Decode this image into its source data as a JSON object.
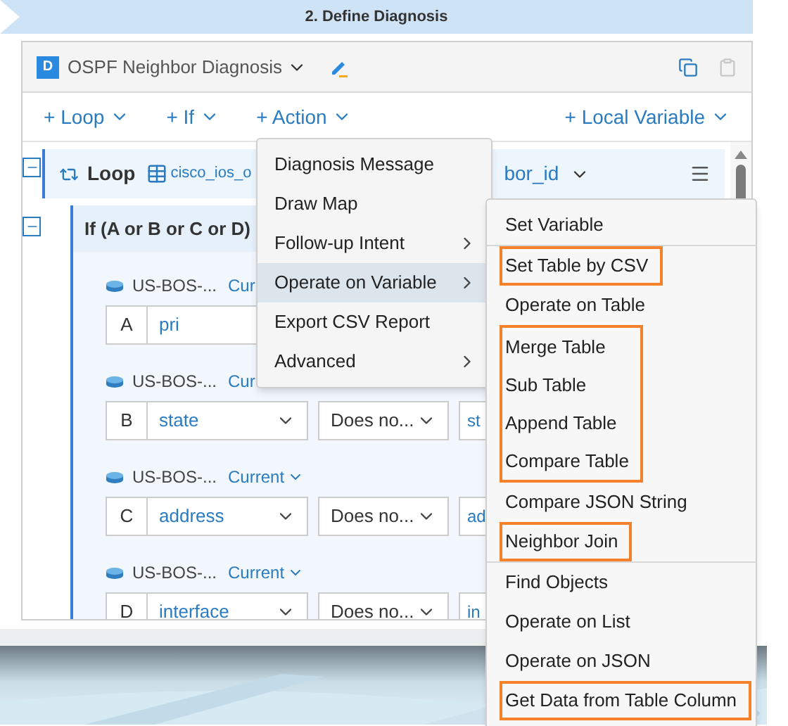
{
  "step_banner": {
    "title": "2. Define Diagnosis"
  },
  "diagnosis": {
    "badge": "D",
    "title": "OSPF Neighbor Diagnosis"
  },
  "toolbar": [
    {
      "label": "+ Loop"
    },
    {
      "label": "+ If"
    },
    {
      "label": "+ Action"
    },
    {
      "label": "+ Local Variable"
    }
  ],
  "loop": {
    "label": "Loop",
    "table": "cisco_ios_o",
    "variable": "bor_id",
    "expanded": true
  },
  "if_block": {
    "title": "If (A or B or C or D)",
    "expanded": true,
    "conditions": [
      {
        "device": "US-BOS-...",
        "mode": "Cur",
        "caret": false,
        "letter": "A",
        "field": "pri",
        "field_caret": false
      },
      {
        "device": "US-BOS-...",
        "mode": "Cur",
        "caret": false,
        "letter": "B",
        "field": "state",
        "field_caret": true,
        "operator": "Does no...",
        "value": "st"
      },
      {
        "device": "US-BOS-...",
        "mode": "Current",
        "caret": true,
        "letter": "C",
        "field": "address",
        "field_caret": true,
        "operator": "Does no...",
        "value": "ad"
      },
      {
        "device": "US-BOS-...",
        "mode": "Current",
        "caret": true,
        "letter": "D",
        "field": "interface",
        "field_caret": true,
        "operator": "Does no...",
        "value": "in"
      }
    ]
  },
  "action_menu": {
    "items": [
      {
        "label": "Diagnosis Message",
        "submenu": false,
        "selected": false
      },
      {
        "label": "Draw Map",
        "submenu": false,
        "selected": false
      },
      {
        "label": "Follow-up Intent",
        "submenu": true,
        "selected": false
      },
      {
        "label": "Operate on Variable",
        "submenu": true,
        "selected": true
      },
      {
        "label": "Export CSV Report",
        "submenu": false,
        "selected": false
      },
      {
        "label": "Advanced",
        "submenu": true,
        "selected": false
      }
    ]
  },
  "variable_submenu": {
    "sections": [
      {
        "items": [
          {
            "label": "Set Variable",
            "highlighted": false
          }
        ]
      },
      {
        "items": [
          {
            "label": "Set Table by CSV",
            "highlighted": true
          },
          {
            "label": "Operate on Table",
            "highlighted": false
          },
          {
            "label": "Merge Table",
            "highlighted": true
          },
          {
            "label": "Sub Table",
            "highlighted": true
          },
          {
            "label": "Append Table",
            "highlighted": true
          },
          {
            "label": "Compare Table",
            "highlighted": true
          },
          {
            "label": "Compare JSON String",
            "highlighted": false
          },
          {
            "label": "Neighbor Join",
            "highlighted": true
          }
        ]
      },
      {
        "items": [
          {
            "label": "Find Objects",
            "highlighted": false
          },
          {
            "label": "Operate on List",
            "highlighted": false
          },
          {
            "label": "Operate on JSON",
            "highlighted": false
          },
          {
            "label": "Get Data from Table Column",
            "highlighted": true
          }
        ]
      }
    ]
  }
}
